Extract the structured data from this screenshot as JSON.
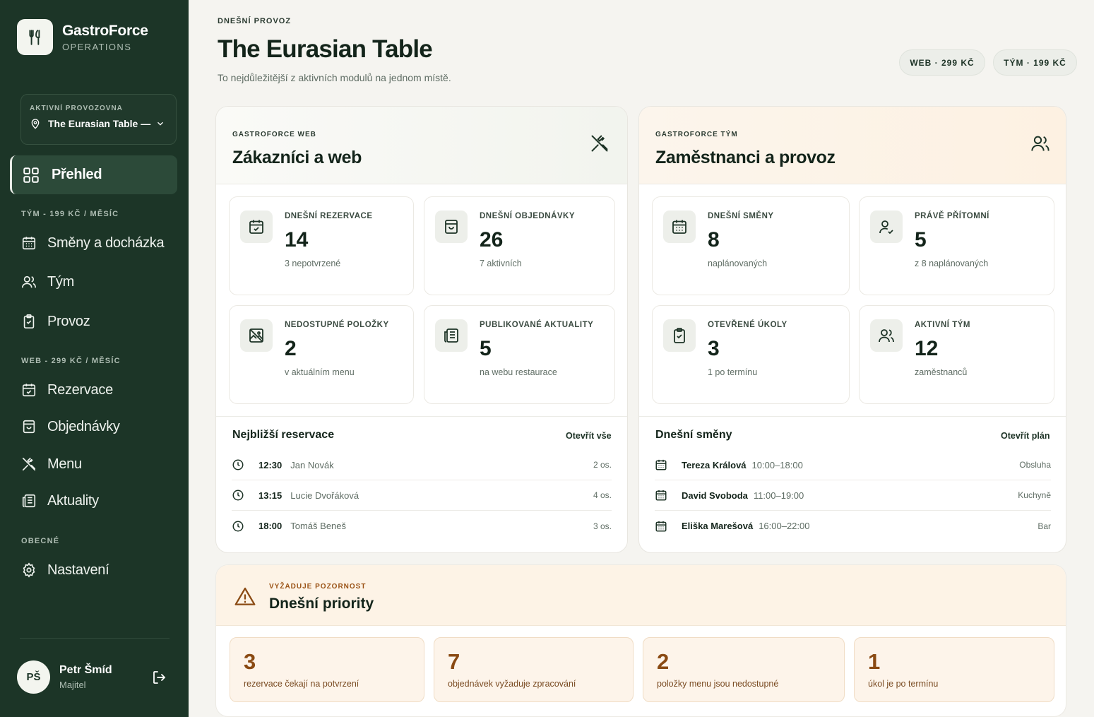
{
  "sidebar": {
    "brand_name": "GastroForce",
    "brand_sub": "OPERATIONS",
    "venue_label": "AKTIVNÍ PROVOZOVNA",
    "venue_value": "The Eurasian Table — Č.",
    "active_item": "Přehled",
    "section_team": "TÝM - 199 KČ / MĚSÍC",
    "items_team": [
      "Směny a docházka",
      "Tým",
      "Provoz"
    ],
    "section_web": "WEB - 299 KČ / MĚSÍC",
    "items_web": [
      "Rezervace",
      "Objednávky",
      "Menu",
      "Aktuality"
    ],
    "section_general": "OBECNÉ",
    "items_general": [
      "Nastavení"
    ],
    "user": {
      "initials": "PŠ",
      "name": "Petr Šmíd",
      "role": "Majitel"
    }
  },
  "header": {
    "kicker": "DNEŠNÍ PROVOZ",
    "title": "The Eurasian Table",
    "subtitle": "To nejdůležitější z aktivních modulů na jednom místě.",
    "pills": [
      "WEB · 299 KČ",
      "TÝM · 199 KČ"
    ]
  },
  "web_panel": {
    "kicker": "GASTROFORCE WEB",
    "title": "Zákazníci a web",
    "cards": [
      {
        "label": "DNEŠNÍ REZERVACE",
        "value": "14",
        "sub": "3 nepotvrzené",
        "icon": "calendar-check-icon"
      },
      {
        "label": "DNEŠNÍ OBJEDNÁVKY",
        "value": "26",
        "sub": "7 aktivních",
        "icon": "shopping-bag-icon"
      },
      {
        "label": "NEDOSTUPNÉ POLOŽKY",
        "value": "2",
        "sub": "v aktuálním menu",
        "icon": "no-image-icon"
      },
      {
        "label": "PUBLIKOVANÉ AKTUALITY",
        "value": "5",
        "sub": "na webu restaurace",
        "icon": "newspaper-icon"
      }
    ],
    "list_title": "Nejbližší reservace",
    "list_link": "Otevřít vše",
    "rows": [
      {
        "time": "12:30",
        "name": "Jan Novák",
        "right": "2 os."
      },
      {
        "time": "13:15",
        "name": "Lucie Dvořáková",
        "right": "4 os."
      },
      {
        "time": "18:00",
        "name": "Tomáš Beneš",
        "right": "3 os."
      }
    ]
  },
  "team_panel": {
    "kicker": "GASTROFORCE TÝM",
    "title": "Zaměstnanci a provoz",
    "cards": [
      {
        "label": "DNEŠNÍ SMĚNY",
        "value": "8",
        "sub": "naplánovaných",
        "icon": "calendar-grid-icon"
      },
      {
        "label": "PRÁVĚ PŘÍTOMNÍ",
        "value": "5",
        "sub": "z 8 naplánovaných",
        "icon": "user-check-icon"
      },
      {
        "label": "OTEVŘENÉ ÚKOLY",
        "value": "3",
        "sub": "1 po termínu",
        "icon": "clipboard-check-icon"
      },
      {
        "label": "AKTIVNÍ TÝM",
        "value": "12",
        "sub": "zaměstnanců",
        "icon": "users-icon"
      }
    ],
    "list_title": "Dnešní směny",
    "list_link": "Otevřít plán",
    "rows": [
      {
        "name": "Tereza Králová",
        "time": "10:00–18:00",
        "right": "Obsluha"
      },
      {
        "name": "David Svoboda",
        "time": "11:00–19:00",
        "right": "Kuchyně"
      },
      {
        "name": "Eliška Marešová",
        "time": "16:00–22:00",
        "right": "Bar"
      }
    ]
  },
  "priorities": {
    "kicker": "VYŽADUJE POZORNOST",
    "title": "Dnešní priority",
    "items": [
      {
        "value": "3",
        "label": "rezervace čekají na potvrzení"
      },
      {
        "value": "7",
        "label": "objednávek vyžaduje zpracování"
      },
      {
        "value": "2",
        "label": "položky menu jsou nedostupné"
      },
      {
        "value": "1",
        "label": "úkol je po termínu"
      }
    ]
  }
}
